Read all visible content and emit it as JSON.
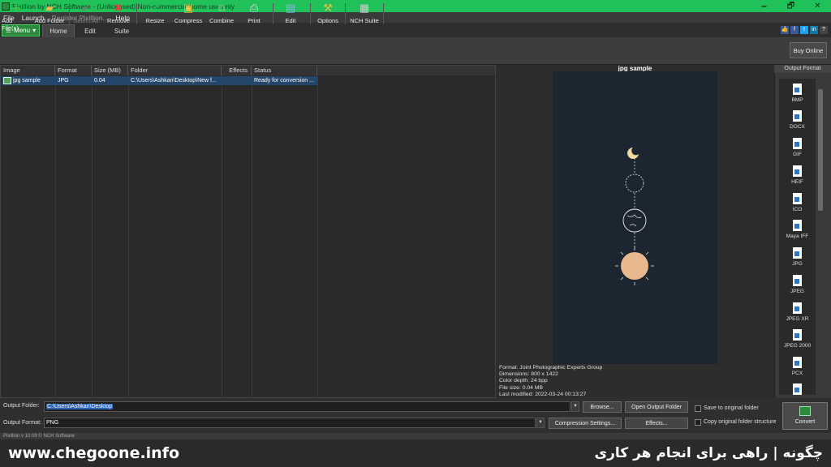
{
  "window": {
    "title": "Pixillion by NCH Software - (Unlicensed) Non-commercial home use only",
    "buttons": {
      "minimize": "🗕",
      "maximize": "🗗",
      "close": "✕"
    }
  },
  "menubar": {
    "items": [
      "File",
      "Launch",
      "Register Pixillion...",
      "Help"
    ]
  },
  "tabs": {
    "menu": "Menu",
    "home": "Home",
    "edit": "Edit",
    "suite": "Suite"
  },
  "toolbar": {
    "add_files": "Add File(s)",
    "add_folder": "Add Folder",
    "select_all": "Select All",
    "remove": "Remove",
    "resize": "Resize",
    "compress": "Compress",
    "combine": "Combine",
    "print": "Print",
    "edit": "Edit",
    "options": "Options",
    "nch_suite": "NCH Suite",
    "buy_online": "Buy Online"
  },
  "filelist": {
    "columns": [
      "Image",
      "Format",
      "Size (MB)",
      "Folder",
      "Effects",
      "Status"
    ],
    "rows": [
      {
        "image": "jpg sample",
        "format": "JPG",
        "size": "0.04",
        "folder": "C:\\Users\\Ashkan\\Desktop\\New f...",
        "effects": "",
        "status": "Ready for conversion ..."
      }
    ]
  },
  "preview": {
    "title": "jpg sample",
    "info": {
      "format": "Format: Joint Photographic Experts Group",
      "dimensions": "Dimensions: 800 x 1422",
      "color_depth": "Color depth: 24 bpp",
      "file_size": "File size: 0.04 MB",
      "last_modified": "Last modified: 2022-03-24 00:13:27"
    }
  },
  "output_formats": {
    "header": "Output Format",
    "items": [
      "BMP",
      "DOCX",
      "GIF",
      "HEIF",
      "ICO",
      "Maya IFF",
      "JPG",
      "JPEG",
      "JPEG XR",
      "JPEG 2000",
      "PCX",
      ""
    ]
  },
  "bottom": {
    "output_folder_label": "Output Folder:",
    "output_folder_value": "C:\\Users\\Ashkan\\Desktop",
    "output_format_label": "Output Format:",
    "output_format_value": "PNG",
    "browse": "Browse...",
    "open_output_folder": "Open Output Folder",
    "compression_settings": "Compression Settings...",
    "effects": "Effects...",
    "save_to_original": "Save to original folder",
    "copy_structure": "Copy original folder structure",
    "convert": "Convert"
  },
  "status": {
    "text": "Pixillion v 10.09 © NCH Software"
  },
  "watermark": {
    "url": "www.chegoone.info",
    "tagline": "چگونه | راهی برای انجام هر کاری"
  },
  "colors": {
    "titlebar": "#1fc158",
    "selection": "#23466a",
    "accent_green": "#2c8a3c"
  }
}
